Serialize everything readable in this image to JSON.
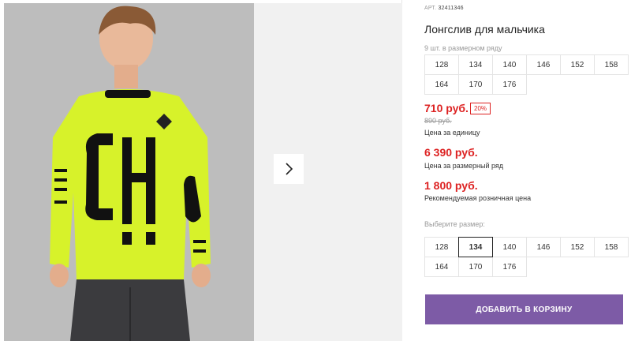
{
  "product": {
    "article_label": "АРТ.",
    "article_number": "32411346",
    "title": "Лонгслив для мальчика",
    "sizes_note": "9 шт. в размерном ряду"
  },
  "size_row": [
    "128",
    "134",
    "140",
    "146",
    "152",
    "158",
    "164",
    "170",
    "176"
  ],
  "pricing": {
    "unit_price": "710 руб.",
    "discount_badge": "20%",
    "old_price": "890 руб.",
    "unit_label": "Цена за единицу",
    "row_price": "6 390 руб.",
    "row_label": "Цена за размерный ряд",
    "retail_price": "1 800 руб.",
    "retail_label": "Рекомендуемая розничная цена"
  },
  "size_picker": {
    "label": "Выберите размер:",
    "sizes": [
      "128",
      "134",
      "140",
      "146",
      "152",
      "158",
      "164",
      "170",
      "176"
    ],
    "selected": "134"
  },
  "cart_button": "ДОБАВИТЬ В КОРЗИНУ",
  "colors": {
    "price_red": "#dd2222",
    "button_purple": "#7d5ba6",
    "shirt_neon": "#d7f22a"
  },
  "icons": {
    "next": "chevron-right-icon"
  }
}
